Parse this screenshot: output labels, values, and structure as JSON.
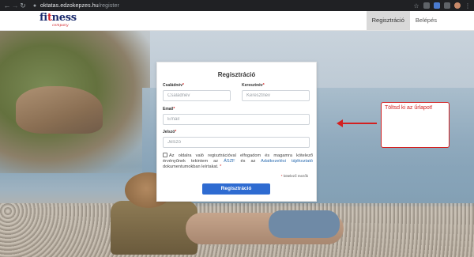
{
  "browser": {
    "url_domain": "oktatas.edzokepzes.hu",
    "url_path": "/register"
  },
  "site": {
    "logo_main_1": "fi",
    "logo_main_red": "t",
    "logo_main_2": "ness",
    "logo_sub": "company",
    "nav": [
      "Regisztráció",
      "Belépés"
    ]
  },
  "annotation": {
    "text": "Töltsd ki az űrlapot!"
  },
  "form": {
    "title": "Regisztráció",
    "last_name": {
      "label": "Családnév",
      "placeholder": "Családnév"
    },
    "first_name": {
      "label": "Keresztnév",
      "placeholder": "Keresztnév"
    },
    "email": {
      "label": "Email",
      "placeholder": "Email"
    },
    "password": {
      "label": "Jelszó",
      "placeholder": "Jelszó"
    },
    "required_mark": "*",
    "consent_part1": "Az oldalra való regisztrációval elfogadom és magamra kötelező érvényűnek tekintem az ",
    "consent_link1": "ÁSZF",
    "consent_part2": " és az ",
    "consent_link2": "Adatkezelési tájékoztató",
    "consent_part3": " dokumentumokban leírtakat. ",
    "required_note": "kötelező mezők",
    "submit_label": "Regisztráció"
  },
  "colors": {
    "accent": "#2e6bd1",
    "annotation": "#d32020",
    "logo_blue": "#1b2b6d",
    "logo_red": "#d2232a"
  }
}
